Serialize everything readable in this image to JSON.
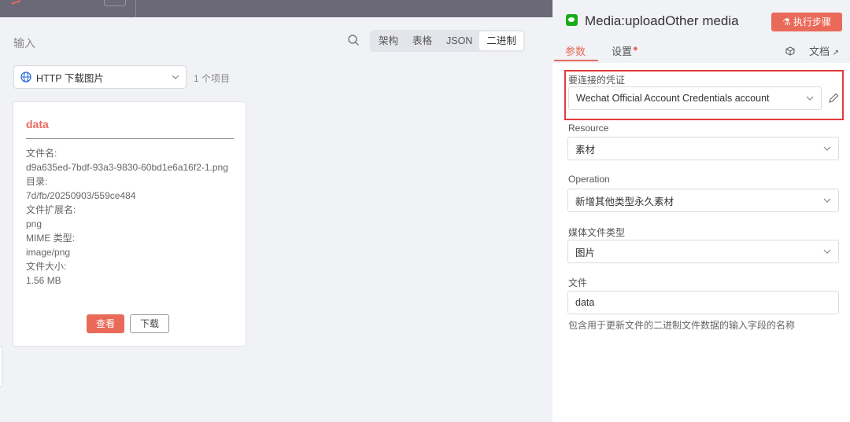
{
  "input_panel": {
    "title": "输入",
    "view_tabs": [
      "架构",
      "表格",
      "JSON",
      "二进制"
    ],
    "active_view": "二进制",
    "source_node": "HTTP 下载图片",
    "item_count": "1 个项目",
    "binary": {
      "key": "data",
      "file_name_label": "文件名:",
      "file_name": "d9a635ed-7bdf-93a3-9830-60bd1e6a16f2-1.png",
      "dir_label": "目录:",
      "dir": "7d/fb/20250903/559ce484",
      "ext_label": "文件扩展名:",
      "ext": "png",
      "mime_label": "MIME 类型:",
      "mime": "image/png",
      "size_label": "文件大小:",
      "size": "1.56 MB",
      "view_button": "查看",
      "download_button": "下载"
    }
  },
  "node_panel": {
    "title": "Media:uploadOther media",
    "execute_button": "执行步骤",
    "tabs": {
      "params": "参数",
      "settings": "设置"
    },
    "docs_link": "文档",
    "fields": {
      "credential": {
        "label": "要连接的凭证",
        "value": "Wechat Official Account Credentials account"
      },
      "resource": {
        "label": "Resource",
        "value": "素材"
      },
      "operation": {
        "label": "Operation",
        "value": "新增其他类型永久素材"
      },
      "media_type": {
        "label": "媒体文件类型",
        "value": "图片"
      },
      "file": {
        "label": "文件",
        "value": "data",
        "hint": "包含用于更新文件的二进制文件数据的输入字段的名称"
      }
    }
  },
  "colors": {
    "accent": "#ea6a5a",
    "highlight_border": "#e23a3a",
    "wechat_green": "#1aad19"
  }
}
